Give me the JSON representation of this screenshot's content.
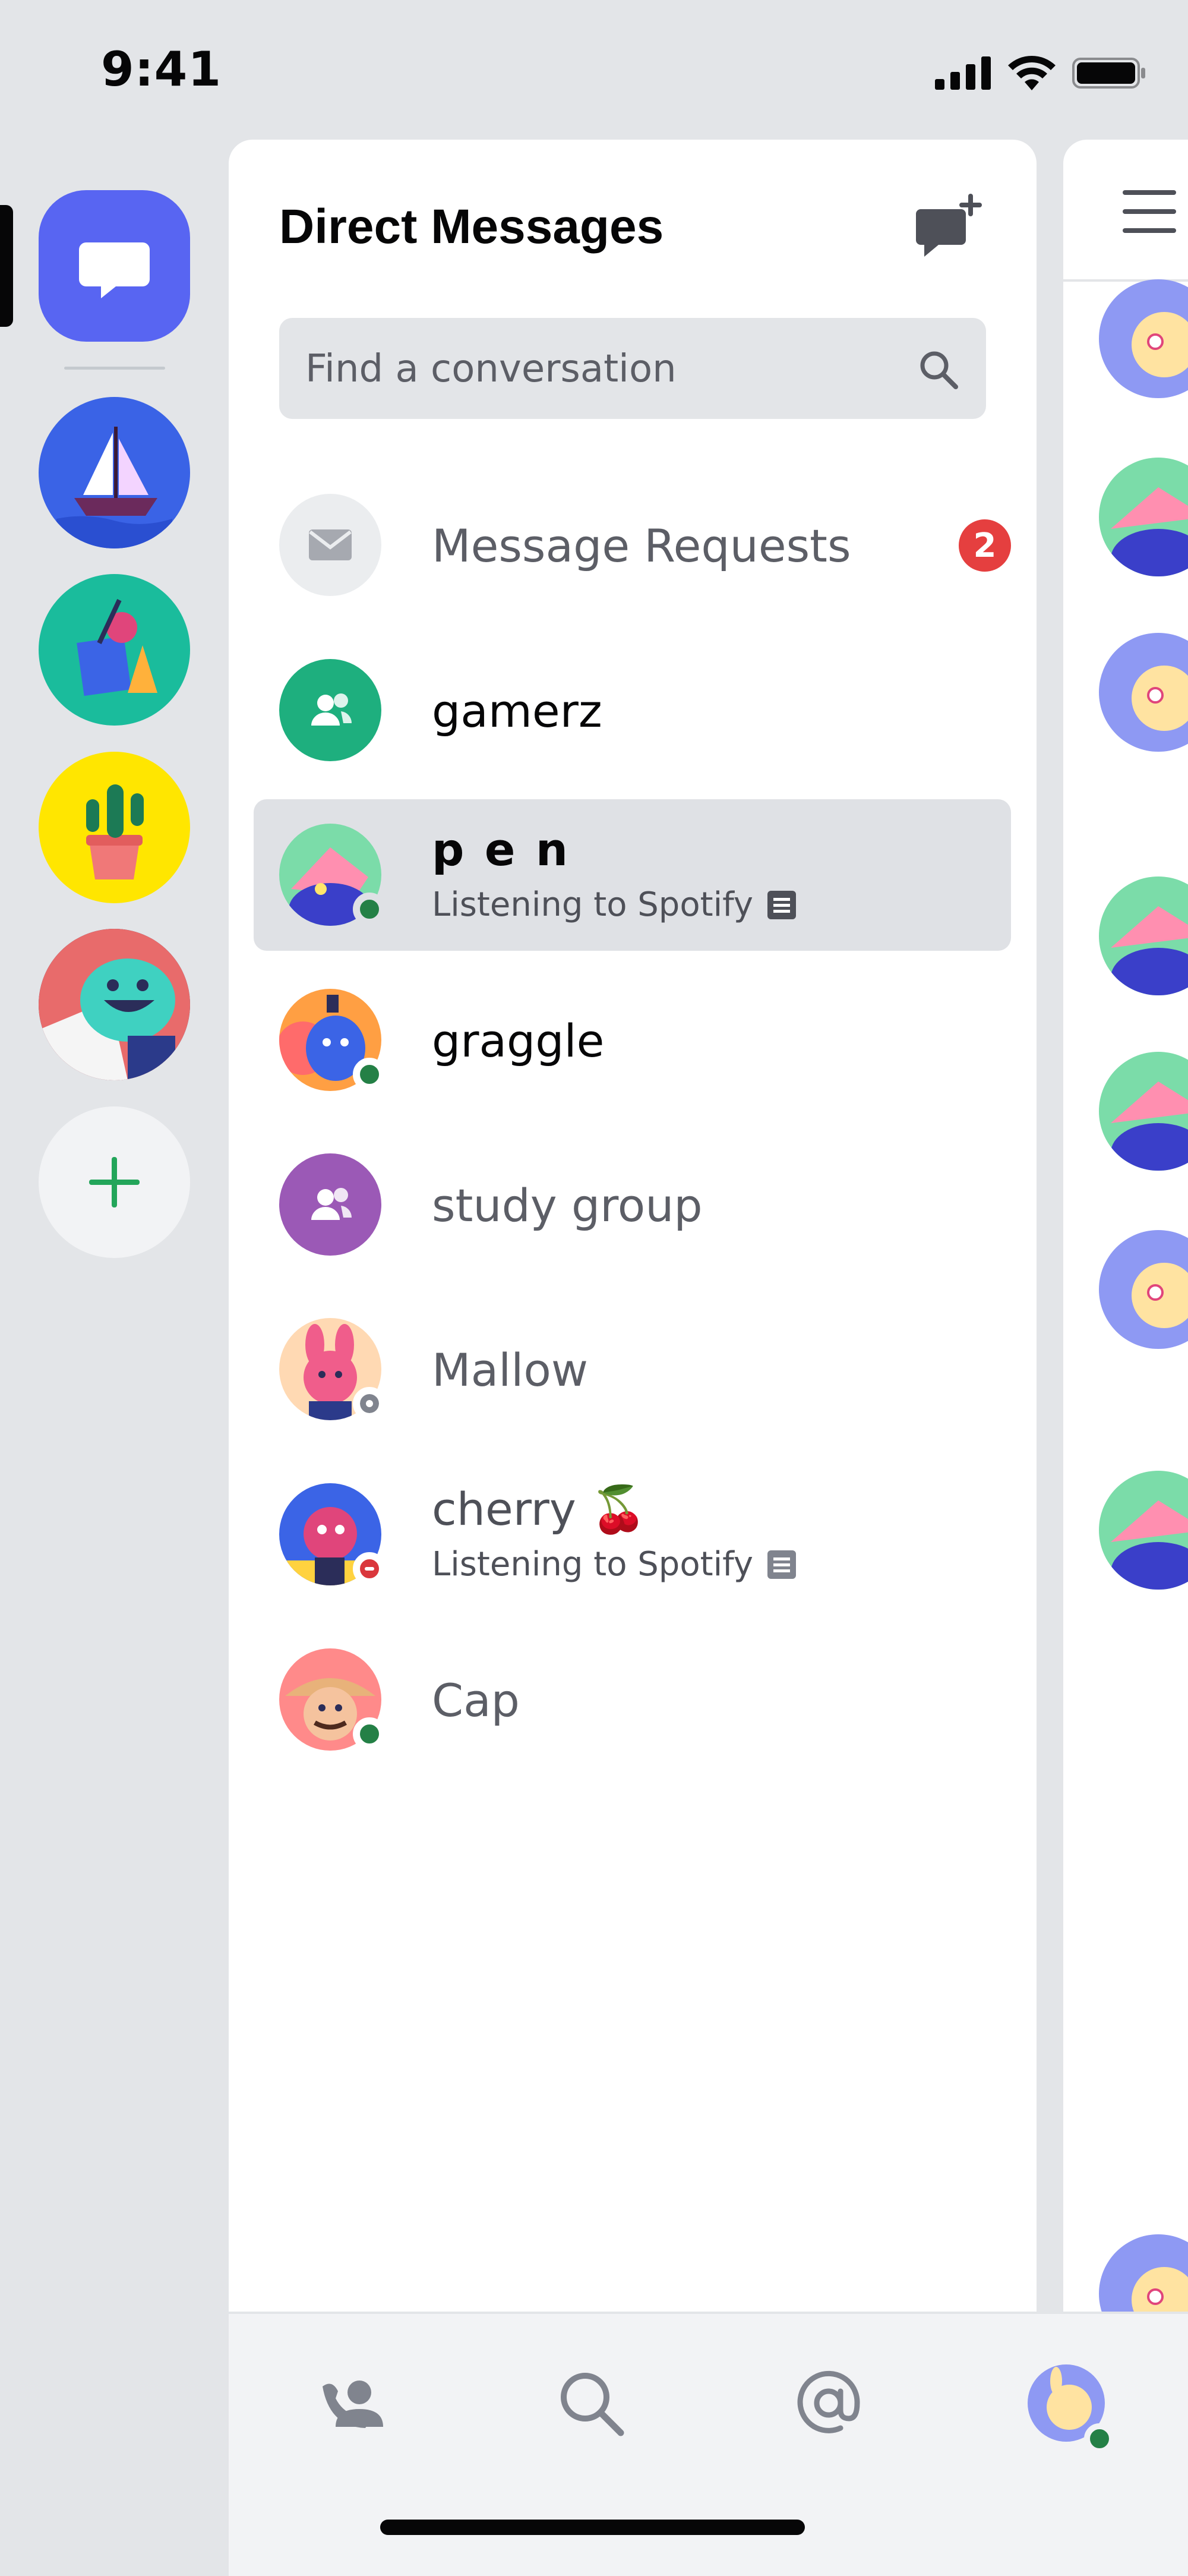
{
  "status_bar": {
    "time": "9:41"
  },
  "servers": [
    {
      "name": "direct-messages",
      "icon": "chat-bubble-icon",
      "color": "#5865f2",
      "selected": true
    },
    {
      "name": "ship-server",
      "icon": "ship-icon",
      "color": "#3a63e6"
    },
    {
      "name": "art-server",
      "icon": "shapes-icon",
      "color": "#1abc9c"
    },
    {
      "name": "cactus-server",
      "icon": "cactus-icon",
      "color": "#ffe600"
    },
    {
      "name": "monster-server",
      "icon": "monster-icon",
      "color": "#2b2d59"
    },
    {
      "name": "add-server",
      "icon": "plus-icon",
      "color": "#23a55a"
    }
  ],
  "dm_panel": {
    "title": "Direct Messages",
    "search_placeholder": "Find a conversation",
    "message_requests": {
      "label": "Message Requests",
      "count": "2"
    },
    "conversations": [
      {
        "name": "gamerz",
        "type": "group",
        "avatar_color": "#1eaf7e"
      },
      {
        "name": "p e n",
        "subtitle": "Listening to Spotify",
        "status": "online",
        "selected": true
      },
      {
        "name": "graggle",
        "status": "online"
      },
      {
        "name": "study group",
        "type": "group",
        "avatar_color": "#9b59b6"
      },
      {
        "name": "Mallow",
        "status": "offline"
      },
      {
        "name": "cherry 🍒",
        "subtitle": "Listening to Spotify",
        "status": "dnd"
      },
      {
        "name": "Cap",
        "status": "online"
      }
    ]
  },
  "bottom_nav": {
    "items": [
      {
        "name": "friends-icon"
      },
      {
        "name": "search-icon"
      },
      {
        "name": "mentions-icon"
      },
      {
        "name": "profile-avatar"
      }
    ]
  },
  "colors": {
    "online": "#248046",
    "dnd": "#da373c",
    "offline": "#80848e",
    "badge": "#e53f3f",
    "blurple": "#5865f2"
  }
}
